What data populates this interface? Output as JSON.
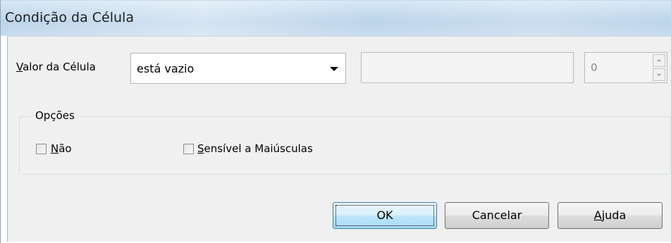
{
  "window": {
    "title": "Condição da Célula"
  },
  "condition": {
    "label_accesskey": "V",
    "label_rest": "alor da Célula",
    "operator_value": "está vazio",
    "value_field": "",
    "count_value": "0"
  },
  "options": {
    "title": "Opções",
    "not_accesskey": "N",
    "not_rest": "ão",
    "case_accesskey": "S",
    "case_rest": "ensível a Maiúsculas"
  },
  "buttons": {
    "ok": "OK",
    "cancel": "Cancelar",
    "help_accesskey": "A",
    "help_rest": "juda"
  },
  "icons": {
    "dropdown": "chevron-down-icon",
    "spin_up": "spin-up-icon",
    "spin_down": "spin-down-icon"
  }
}
